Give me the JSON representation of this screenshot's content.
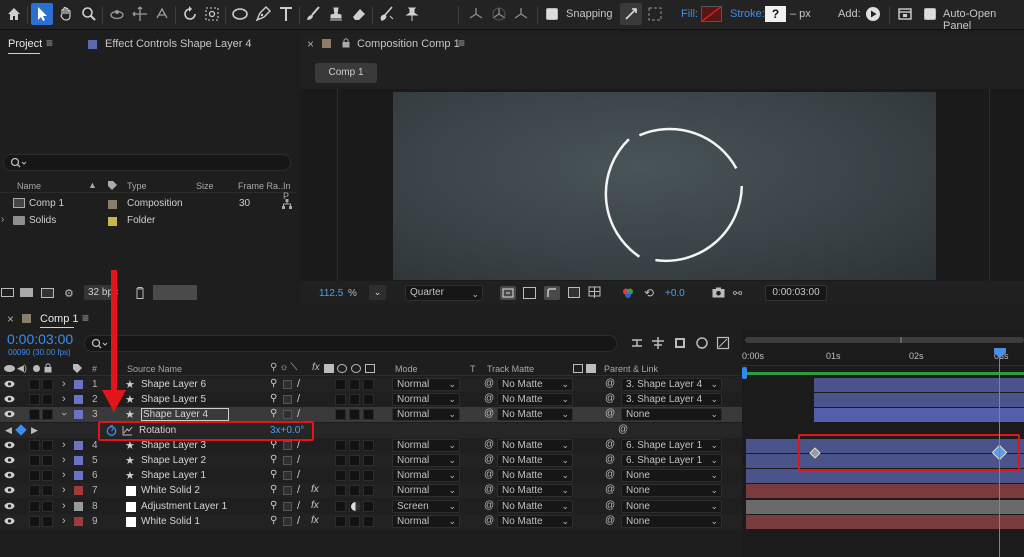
{
  "toolbar": {
    "snapping_label": "Snapping",
    "fill_label": "Fill:",
    "stroke_label": "Stroke:",
    "stroke_value": "?",
    "stroke_unit": "– px",
    "add_label": "Add:",
    "auto_open_label": "Auto-Open Panel"
  },
  "project_panel": {
    "tab_project": "Project",
    "tab_effect_controls": "Effect Controls Shape Layer 4",
    "search_placeholder": "",
    "columns": {
      "name": "Name",
      "type": "Type",
      "size": "Size",
      "frame_rate": "Frame Ra...",
      "in_point": "In P"
    },
    "items": [
      {
        "name": "Comp 1",
        "type": "Composition",
        "size": "",
        "frame_rate": "30",
        "color": "#8a7d6a"
      },
      {
        "name": "Solids",
        "type": "Folder",
        "size": "",
        "frame_rate": "",
        "color": "#c9b64a"
      }
    ],
    "bpc": "32 bpc"
  },
  "composition_panel": {
    "tab": "Composition Comp 1",
    "comp_button": "Comp 1",
    "zoom": "112.5",
    "zoom_unit": "%",
    "resolution": "Quarter",
    "exposure": "+0.0",
    "timecode": "0:00:03:00"
  },
  "timeline": {
    "tab": "Comp 1",
    "timecode": "0:00:03:00",
    "frames": "00090 (30.00 fps)",
    "columns": {
      "num": "#",
      "source_name": "Source Name",
      "mode": "Mode",
      "t": "T",
      "track_matte": "Track Matte",
      "parent_link": "Parent & Link"
    },
    "ruler": [
      "0:00s",
      "01s",
      "02s",
      "03s"
    ],
    "layers": [
      {
        "num": "1",
        "name": "Shape Layer 6",
        "type": "shape",
        "label_color": "#6b74c4",
        "mode": "Normal",
        "matte": "No Matte",
        "parent": "3. Shape Layer 4",
        "expanded": false,
        "selected": false,
        "bar": "#4b548a"
      },
      {
        "num": "2",
        "name": "Shape Layer 5",
        "type": "shape",
        "label_color": "#6b74c4",
        "mode": "Normal",
        "matte": "No Matte",
        "parent": "3. Shape Layer 4",
        "expanded": false,
        "selected": false,
        "bar": "#4b548a"
      },
      {
        "num": "3",
        "name": "Shape Layer 4",
        "type": "shape",
        "label_color": "#6b74c4",
        "mode": "Normal",
        "matte": "No Matte",
        "parent": "None",
        "expanded": true,
        "selected": true,
        "bar": "#4b548a"
      },
      {
        "num": "4",
        "name": "Shape Layer 3",
        "type": "shape",
        "label_color": "#6b74c4",
        "mode": "Normal",
        "matte": "No Matte",
        "parent": "6. Shape Layer 1",
        "expanded": false,
        "selected": false,
        "bar": "#4b548a"
      },
      {
        "num": "5",
        "name": "Shape Layer 2",
        "type": "shape",
        "label_color": "#6b74c4",
        "mode": "Normal",
        "matte": "No Matte",
        "parent": "6. Shape Layer 1",
        "expanded": false,
        "selected": false,
        "bar": "#4b548a"
      },
      {
        "num": "6",
        "name": "Shape Layer 1",
        "type": "shape",
        "label_color": "#6b74c4",
        "mode": "Normal",
        "matte": "No Matte",
        "parent": "None",
        "expanded": false,
        "selected": false,
        "bar": "#4b548a"
      },
      {
        "num": "7",
        "name": "White Solid 2",
        "type": "solid",
        "label_color": "#a13a3a",
        "mode": "Normal",
        "matte": "No Matte",
        "parent": "None",
        "expanded": false,
        "selected": false,
        "bar": "#7a3b3f"
      },
      {
        "num": "8",
        "name": "Adjustment Layer 1",
        "type": "adjustment",
        "label_color": "#9a9a9a",
        "mode": "Screen",
        "matte": "No Matte",
        "parent": "None",
        "expanded": false,
        "selected": false,
        "bar": "#6a6a6a"
      },
      {
        "num": "9",
        "name": "White Solid 1",
        "type": "solid",
        "label_color": "#a13a3a",
        "mode": "Normal",
        "matte": "No Matte",
        "parent": "None",
        "expanded": false,
        "selected": false,
        "bar": "#7a3b3f"
      }
    ],
    "property": {
      "name": "Rotation",
      "value": "3x+0.0°"
    }
  },
  "colors": {
    "accent": "#2d8ceb",
    "highlight": "#e4141c",
    "shape_label": "#6b74c4",
    "solid_label": "#a13a3a"
  }
}
